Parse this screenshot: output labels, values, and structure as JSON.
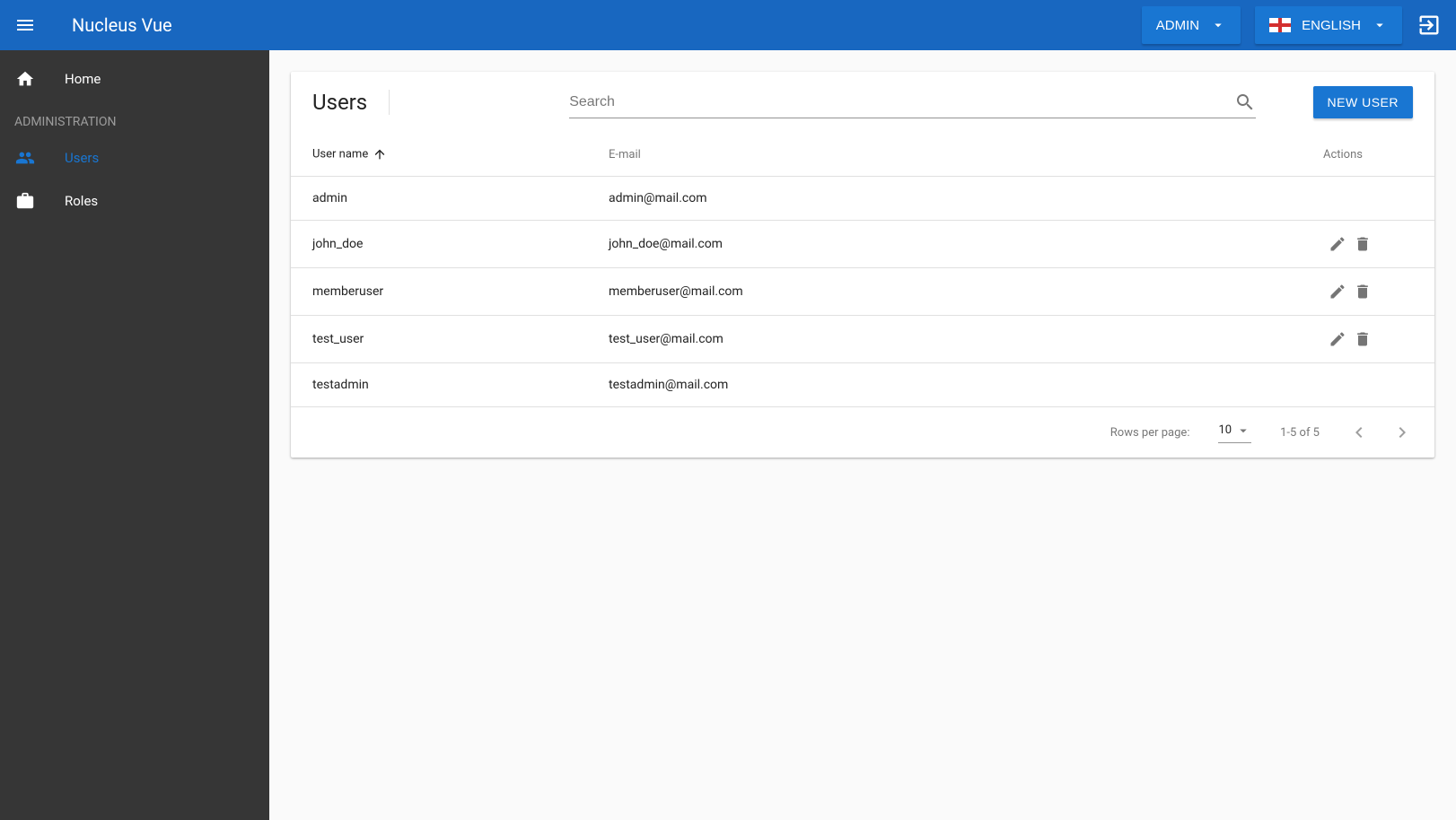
{
  "header": {
    "app_title": "Nucleus Vue",
    "user_label": "ADMIN",
    "language_label": "ENGLISH"
  },
  "sidebar": {
    "home_label": "Home",
    "section_label": "ADMINISTRATION",
    "users_label": "Users",
    "roles_label": "Roles"
  },
  "page": {
    "title": "Users",
    "search_placeholder": "Search",
    "new_user_label": "NEW USER"
  },
  "table": {
    "headers": {
      "username": "User name",
      "email": "E-mail",
      "actions": "Actions"
    },
    "rows": [
      {
        "username": "admin",
        "email": "admin@mail.com",
        "editable": false
      },
      {
        "username": "john_doe",
        "email": "john_doe@mail.com",
        "editable": true
      },
      {
        "username": "memberuser",
        "email": "memberuser@mail.com",
        "editable": true
      },
      {
        "username": "test_user",
        "email": "test_user@mail.com",
        "editable": true
      },
      {
        "username": "testadmin",
        "email": "testadmin@mail.com",
        "editable": false
      }
    ]
  },
  "pagination": {
    "rows_label": "Rows per page:",
    "rows_value": "10",
    "range_text": "1-5 of 5"
  }
}
